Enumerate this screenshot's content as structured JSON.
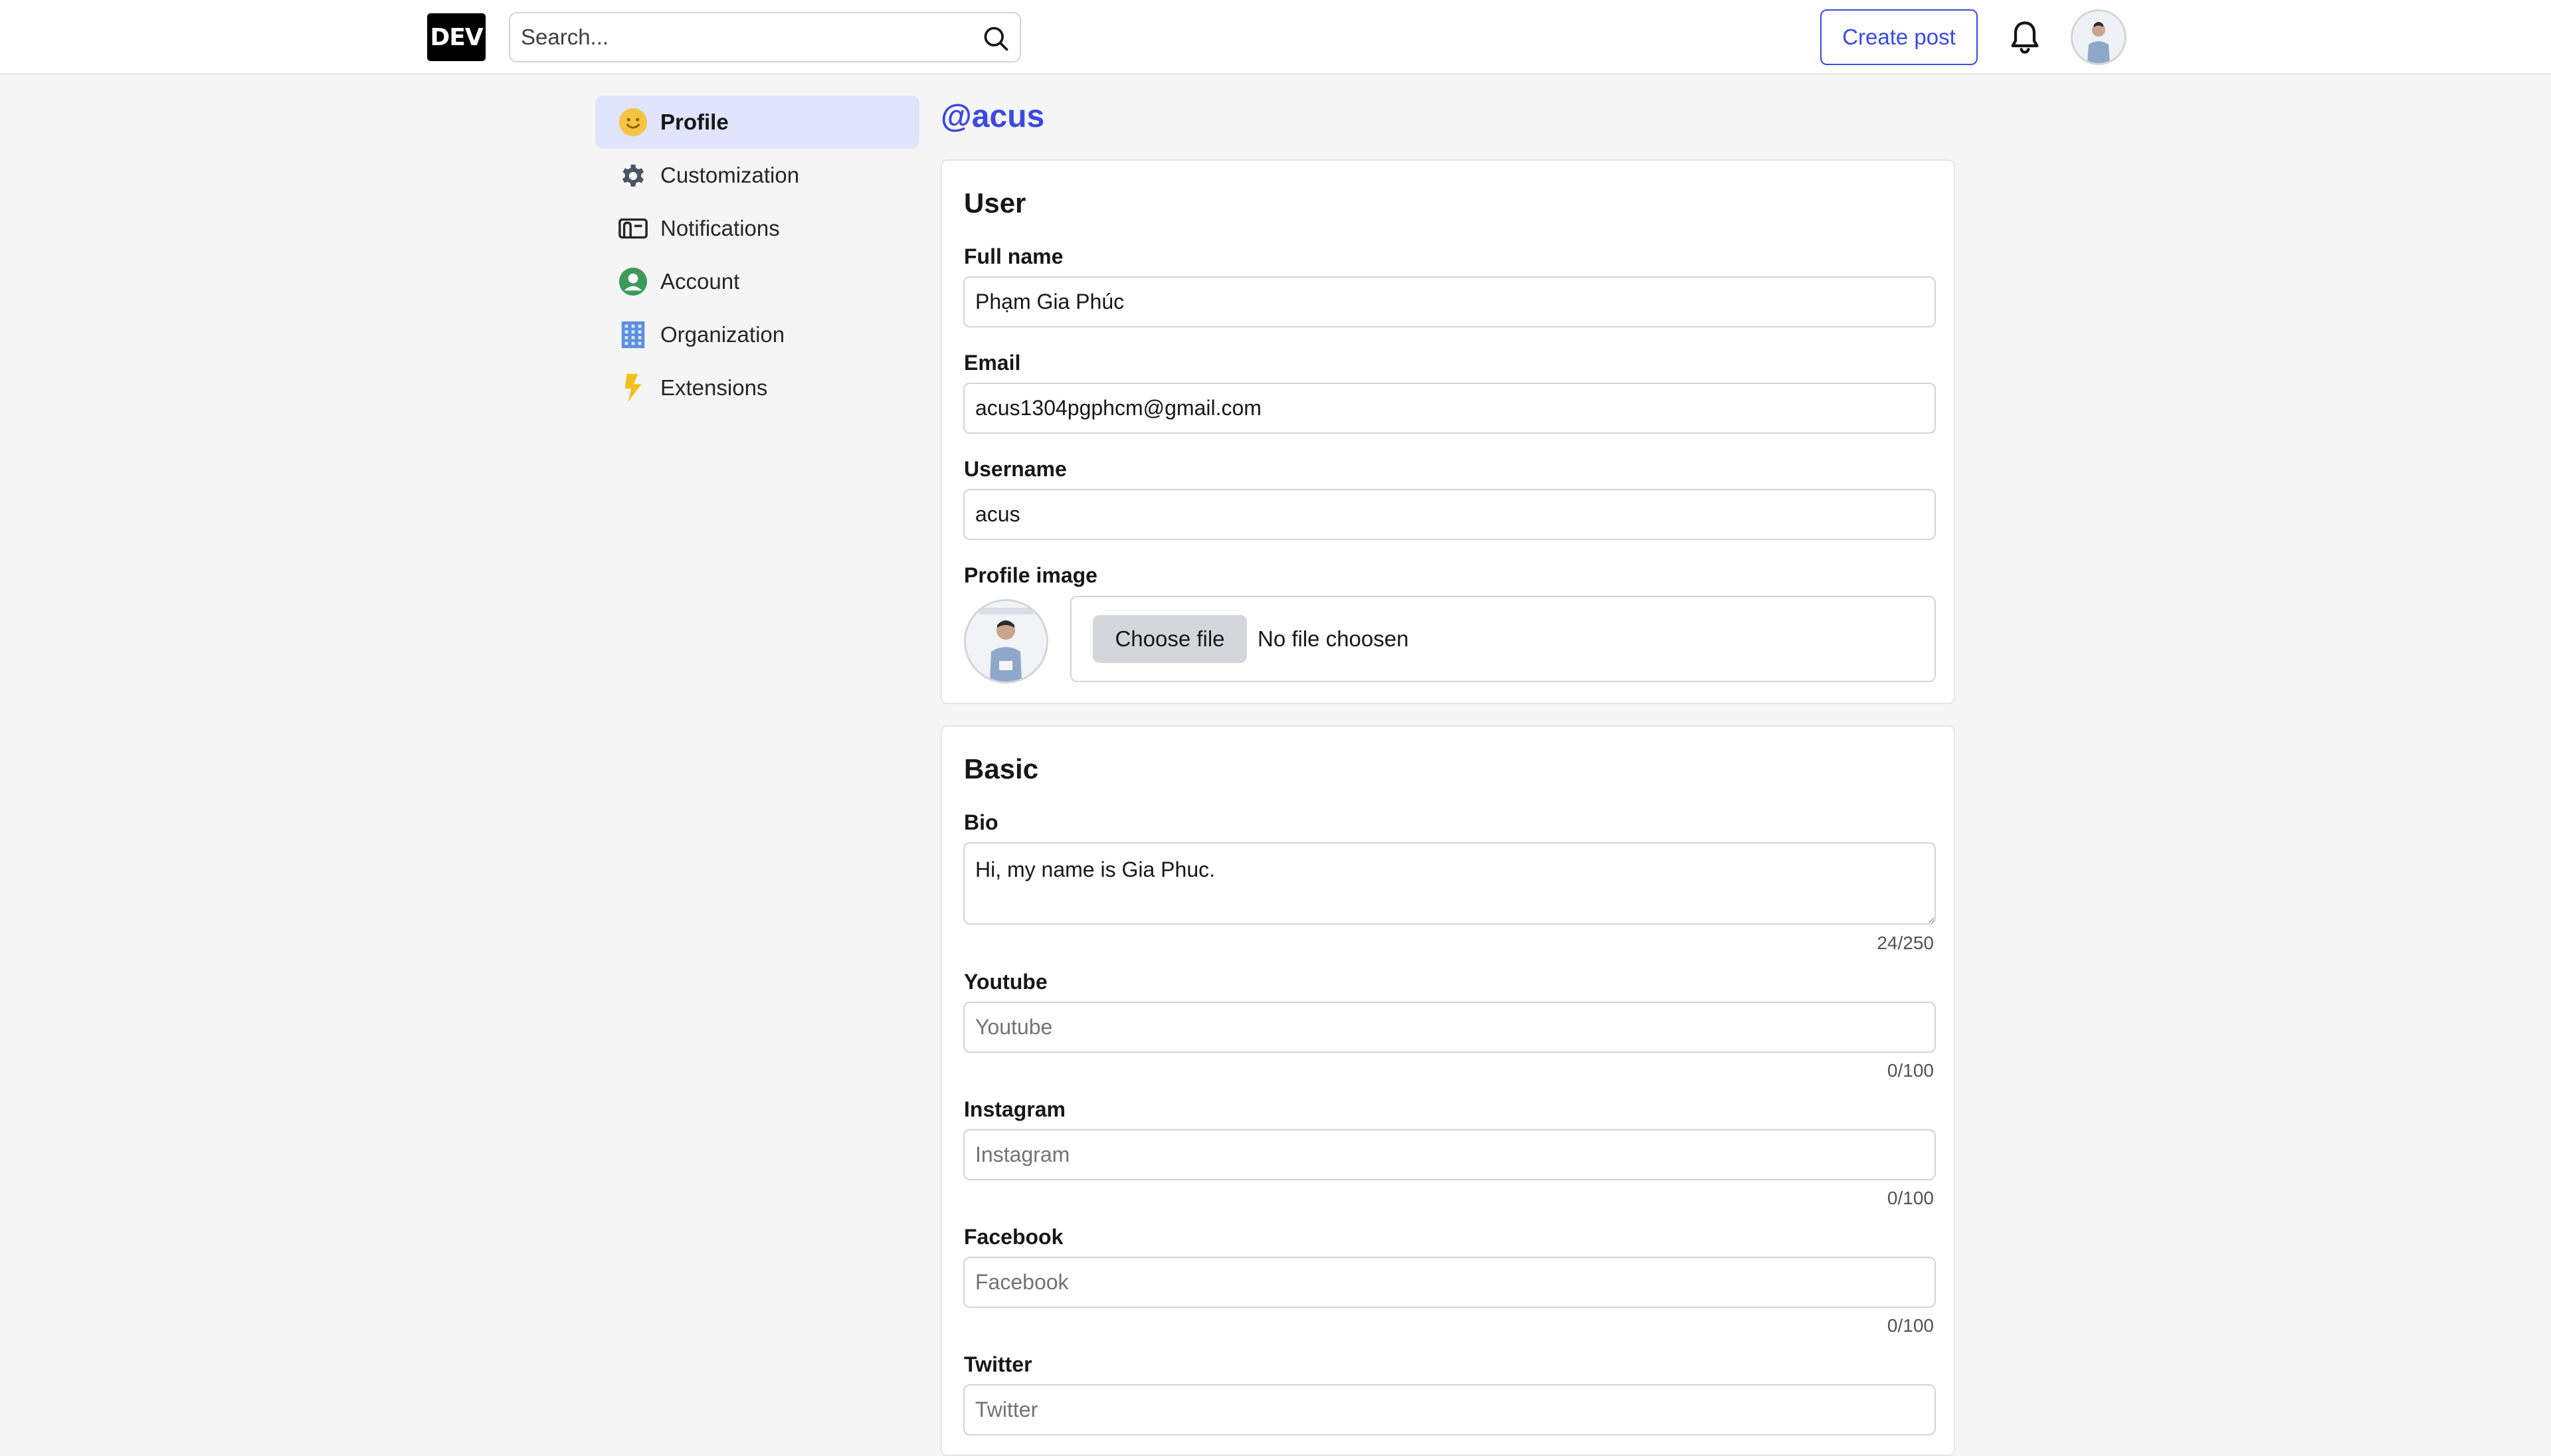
{
  "header": {
    "logo": "DEV",
    "search_placeholder": "Search...",
    "create_post_label": "Create post",
    "icons": [
      "search-icon",
      "bell-icon"
    ]
  },
  "sidebar": {
    "items": [
      {
        "label": "Profile",
        "icon": "smiley-icon",
        "active": true
      },
      {
        "label": "Customization",
        "icon": "gear-icon"
      },
      {
        "label": "Notifications",
        "icon": "mailbox-icon"
      },
      {
        "label": "Account",
        "icon": "user-circle-icon"
      },
      {
        "label": "Organization",
        "icon": "building-icon"
      },
      {
        "label": "Extensions",
        "icon": "lightning-icon"
      }
    ]
  },
  "main": {
    "handle": "@acus",
    "user_section": {
      "title": "User",
      "full_name_label": "Full name",
      "full_name_value": "Phạm Gia Phúc",
      "email_label": "Email",
      "email_value": "acus1304pgphcm@gmail.com",
      "username_label": "Username",
      "username_value": "acus",
      "profile_image_label": "Profile image",
      "choose_file_label": "Choose file",
      "no_file_text": "No file choosen"
    },
    "basic_section": {
      "title": "Basic",
      "bio_label": "Bio",
      "bio_value": "Hi, my name is Gia Phuc.",
      "bio_counter": "24/250",
      "youtube_label": "Youtube",
      "youtube_placeholder": "Youtube",
      "youtube_counter": "0/100",
      "instagram_label": "Instagram",
      "instagram_placeholder": "Instagram",
      "instagram_counter": "0/100",
      "facebook_label": "Facebook",
      "facebook_placeholder": "Facebook",
      "facebook_counter": "0/100",
      "twitter_label": "Twitter",
      "twitter_placeholder": "Twitter"
    }
  },
  "colors": {
    "accent": "#3b49df",
    "active_nav_bg": "#e0e4fc",
    "page_bg": "#f5f5f5"
  }
}
